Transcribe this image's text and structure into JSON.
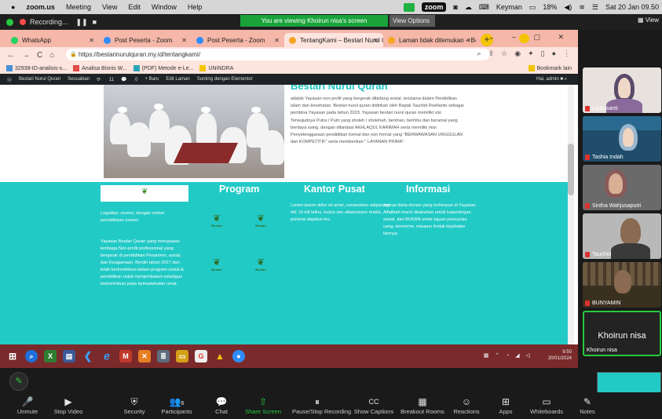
{
  "mac_menubar": {
    "app": "zoom.us",
    "menus": [
      "Meeting",
      "View",
      "Edit",
      "Window",
      "Help"
    ],
    "zoom_label": "zoom",
    "keyman": "Keyman",
    "battery": "18%",
    "datetime": "Sat 20 Jan  09.50"
  },
  "zoom_top": {
    "recording_label": "Recording...",
    "viewing_banner": "You are viewing Khoirun nisa's screen",
    "view_options": "View Options",
    "view": "View"
  },
  "browser": {
    "tabs": [
      {
        "label": "WhatsApp",
        "color": "#25d366"
      },
      {
        "label": "Post Peserta - Zoom",
        "color": "#2d8cff"
      },
      {
        "label": "Post Peserta - Zoom",
        "color": "#2d8cff"
      },
      {
        "label": "TentangKami – Bestari Nurul Q",
        "color": "#f5a623"
      },
      {
        "label": "Laman tidak ditemukan – Best",
        "color": "#f5a623"
      }
    ],
    "url": "https://bestarinurulquran.my.id/tentangkami/",
    "bookmarks": [
      {
        "label": "32938-ID-analisis-s...",
        "color": "#4a90d9"
      },
      {
        "label": "Analisa Bisnis W...",
        "color": "#e04a4a"
      },
      {
        "label": "(PDF) Metode e-Le...",
        "color": "#2aa3b8"
      },
      {
        "label": "UNINDRA",
        "color": "#f5c400"
      }
    ],
    "bookmarks_right": "Bookmark lain"
  },
  "wp_admin": {
    "items": [
      "Bestari Nurul Quran",
      "Sesuaikan",
      "11",
      "0",
      "+ Baru",
      "Edit Laman",
      "Sunting dengan Elementor"
    ],
    "greeting": "Hai, admin"
  },
  "page": {
    "section_title": "Bestari Nurul Quran",
    "description": "adalah Yayasan non-profit yang bergerak dibidang sosial, terutama dalam Pendidikan islam dan kesehatan. Bestari nurul quran didirikan oleh Bapak Tauchid Roellanto sebagai pembina Yayasan pada tahun 2023. Yayasan bestari nurul quran memiliki visi Terwujudnya Putra / Putri yang sholeh / sholehah, beriman, berilmu dan beramal yang berdaya saing, dengan dilandasi AKHLAQUL KARIMAH serta memiliki misi Penyelenggaraan pendidikan formal dan non formal yang \"BERWAWASAN UNGGULAN dan KOMPETITIF\" serta memberikan \" LAYANAN PRIMA\".",
    "footer": {
      "legalitas": "Legalitas: xxxxxx, dengan nomor pendaftaran xxxxxx",
      "about": "Yayasan Bestari Quran yang merupakan lembaga Non-profit professional yang bergerak di pendidikan Pesantren, sosial, dan Keagamaan. Berdiri tahun 2017 dan telah berkontribusi dalam program sosial & pendidikan untuk menjembatani sekaligus berkontribusi pada kemaslahatan umat.",
      "program_title": "Program",
      "program_items": [
        "Bestari",
        "Bestari",
        "Bestari",
        "Bestari"
      ],
      "kantor_title": "Kantor Pusat",
      "kantor_text": "Lorem ipsum dolor sit amet, consectetur adipiscing elit. Ut elit tellus, luctus nec ullamcorper mattis, pulvinar dapibus leo.",
      "informasi_title": "Informasi",
      "informasi_text": "semua dana donasi yang terhimpun di Yayasan Alfatihah murni disalurkan untuk kepentingan sosial, dan BUKAN untuk tujuan pencucian uang, terorisme, maupun tindak kejahatan lainnya."
    }
  },
  "taskbar": {
    "time": "9:50",
    "date": "20/01/2024"
  },
  "participants": [
    {
      "name": "LiaSusanti"
    },
    {
      "name": "Tashia Indah"
    },
    {
      "name": "Sintha Wahjusaputri"
    },
    {
      "name": "Tauchid"
    },
    {
      "name": "BUNYAMIN"
    },
    {
      "name": "Khoirun nisa",
      "big_label": "Khoirun nisa"
    }
  ],
  "controls": [
    {
      "label": "Unmute",
      "icon": "🎤"
    },
    {
      "label": "Stop Video",
      "icon": "▶"
    },
    {
      "label": "Security",
      "icon": "⛨"
    },
    {
      "label": "Participants",
      "icon": "👥",
      "count": "6"
    },
    {
      "label": "Chat",
      "icon": "💬"
    },
    {
      "label": "Share Screen",
      "icon": "⇧"
    },
    {
      "label": "Pause/Stop Recording",
      "icon": "⏸"
    },
    {
      "label": "Show Captions",
      "icon": "CC"
    },
    {
      "label": "Breakout Rooms",
      "icon": "▦"
    },
    {
      "label": "Reactions",
      "icon": "☺"
    },
    {
      "label": "Apps",
      "icon": "⊞"
    },
    {
      "label": "Whiteboards",
      "icon": "▭"
    },
    {
      "label": "Notes",
      "icon": "✎"
    }
  ]
}
